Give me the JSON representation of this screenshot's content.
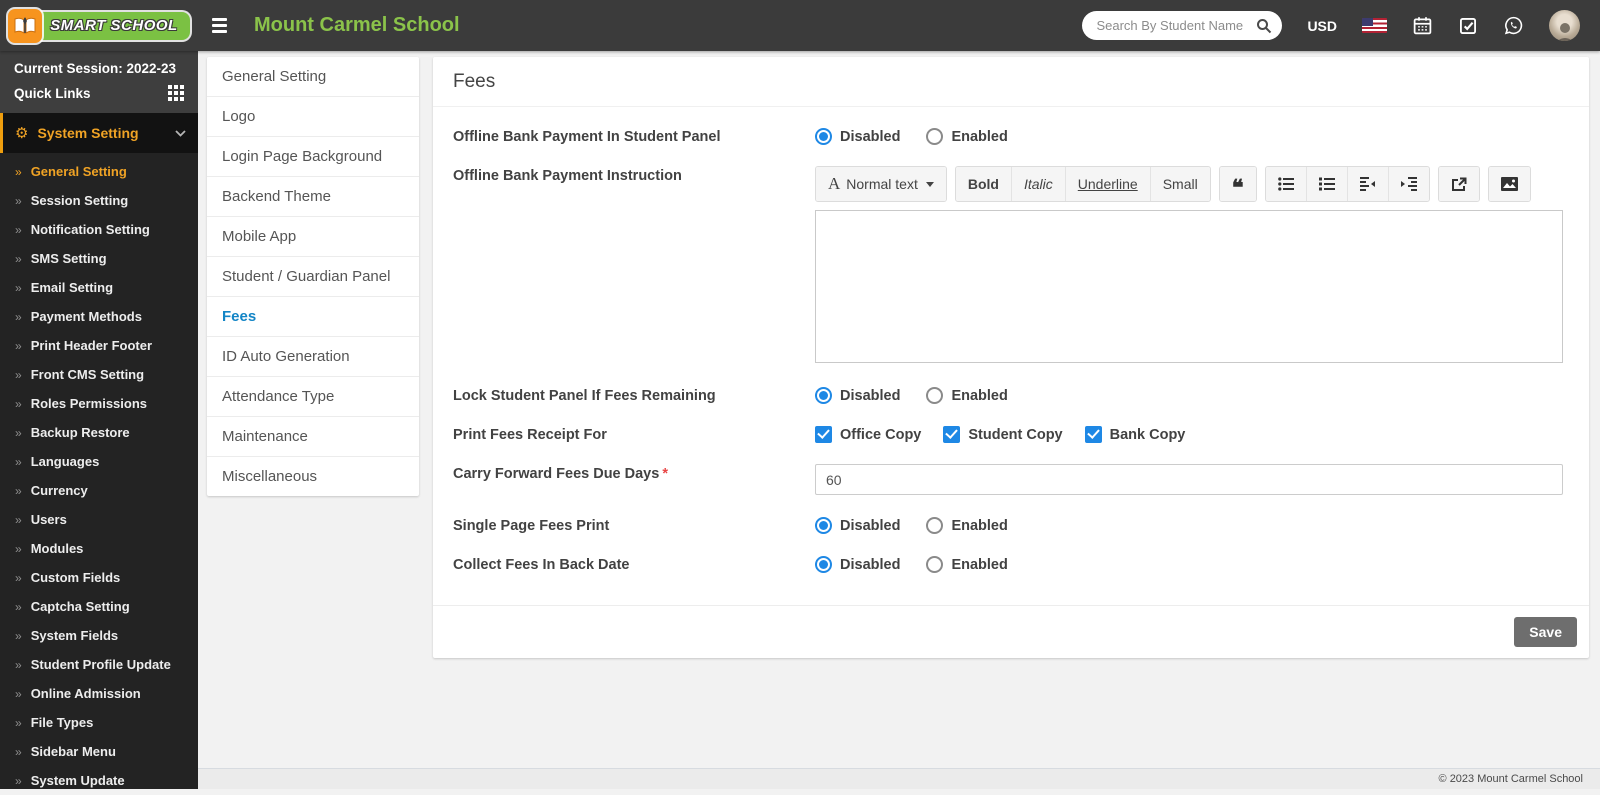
{
  "header": {
    "brand_name": "SMART SCHOOL",
    "school_name": "Mount Carmel School",
    "search_placeholder": "Search By Student Name",
    "currency": "USD"
  },
  "sidebar": {
    "session_label": "Current Session: 2022-23",
    "quick_links_label": "Quick Links",
    "section_label": "System Setting",
    "item_arrow": "»",
    "gear_glyph": "⚙",
    "items": [
      "General Setting",
      "Session Setting",
      "Notification Setting",
      "SMS Setting",
      "Email Setting",
      "Payment Methods",
      "Print Header Footer",
      "Front CMS Setting",
      "Roles Permissions",
      "Backup Restore",
      "Languages",
      "Currency",
      "Users",
      "Modules",
      "Custom Fields",
      "Captcha Setting",
      "System Fields",
      "Student Profile Update",
      "Online Admission",
      "File Types",
      "Sidebar Menu",
      "System Update"
    ],
    "active_item": "General Setting"
  },
  "submenu": {
    "items": [
      "General Setting",
      "Logo",
      "Login Page Background",
      "Backend Theme",
      "Mobile App",
      "Student / Guardian Panel",
      "Fees",
      "ID Auto Generation",
      "Attendance Type",
      "Maintenance",
      "Miscellaneous"
    ],
    "active_item": "Fees"
  },
  "main": {
    "title": "Fees",
    "required_marker": "*",
    "rows": [
      {
        "label": "Offline Bank Payment In Student Panel",
        "type": "radio",
        "options": [
          "Disabled",
          "Enabled"
        ],
        "selected": "Disabled"
      },
      {
        "label": "Offline Bank Payment Instruction",
        "type": "editor",
        "value": ""
      },
      {
        "label": "Lock Student Panel If Fees Remaining",
        "type": "radio",
        "options": [
          "Disabled",
          "Enabled"
        ],
        "selected": "Disabled"
      },
      {
        "label": "Print Fees Receipt For",
        "type": "checkbox",
        "options": [
          "Office Copy",
          "Student Copy",
          "Bank Copy"
        ],
        "checked": [
          "Office Copy",
          "Student Copy",
          "Bank Copy"
        ]
      },
      {
        "label": "Carry Forward Fees Due Days",
        "type": "text",
        "required": true,
        "value": "60"
      },
      {
        "label": "Single Page Fees Print",
        "type": "radio",
        "options": [
          "Disabled",
          "Enabled"
        ],
        "selected": "Disabled"
      },
      {
        "label": "Collect Fees In Back Date",
        "type": "radio",
        "options": [
          "Disabled",
          "Enabled"
        ],
        "selected": "Disabled"
      }
    ],
    "save_label": "Save"
  },
  "editor": {
    "style_icon": "A",
    "style_label": "Normal text",
    "bold_label": "Bold",
    "italic_label": "Italic",
    "underline_label": "Underline",
    "small_label": "Small",
    "quote_glyph": "❝"
  },
  "footer": {
    "copyright": "© 2023 Mount Carmel School"
  },
  "colors": {
    "header_bg": "#3b3b3b",
    "brand_green": "#7bc143",
    "brand_orange": "#f7941e",
    "school_name_green": "#8bc34a",
    "sidebar_accent_orange": "#f0a325",
    "submenu_active_blue": "#1385c6",
    "control_blue": "#1e88e5",
    "save_button_gray": "#6e6e6e"
  }
}
